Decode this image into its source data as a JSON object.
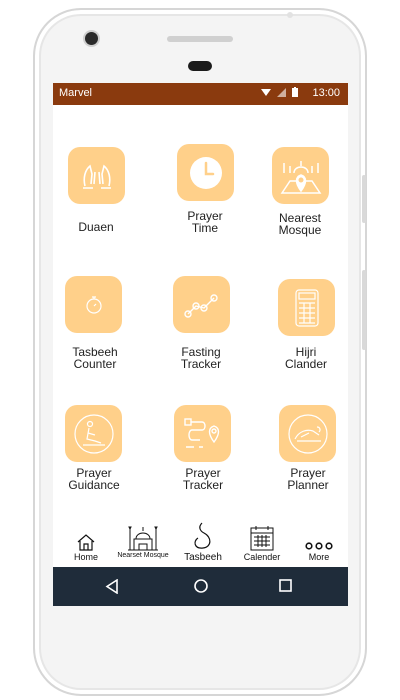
{
  "status_bar": {
    "carrier": "Marvel",
    "time": "13:00"
  },
  "grid": [
    {
      "label": "Duaen",
      "icon": "praying-hands-icon"
    },
    {
      "label": "Prayer\nTime",
      "icon": "clock-icon"
    },
    {
      "label": "Nearest\nMosque",
      "icon": "mosque-map-pin-icon"
    },
    {
      "label": "Tasbeeh\nCounter",
      "icon": "stopwatch-icon"
    },
    {
      "label": "Fasting\nTracker",
      "icon": "graph-icon"
    },
    {
      "label": "Hijri\nClander",
      "icon": "calendar-grid-icon"
    },
    {
      "label": "Prayer\nGuidance",
      "icon": "kneeling-person-icon"
    },
    {
      "label": "Prayer\nTracker",
      "icon": "route-pin-icon"
    },
    {
      "label": "Prayer\nPlanner",
      "icon": "praying-person-icon"
    }
  ],
  "tabs": [
    {
      "label": "Home",
      "icon": "home-icon"
    },
    {
      "label": "Nearset Mosque",
      "icon": "mosque-icon"
    },
    {
      "label": "Tasbeeh",
      "icon": "tasbeeh-icon"
    },
    {
      "label": "Calender",
      "icon": "calendar-icon"
    },
    {
      "label": "More",
      "icon": "more-dots-icon"
    }
  ],
  "colors": {
    "status_bar": "#8a3a0e",
    "tile": "#ffd08a",
    "nav_bar": "#1f2c3a"
  }
}
